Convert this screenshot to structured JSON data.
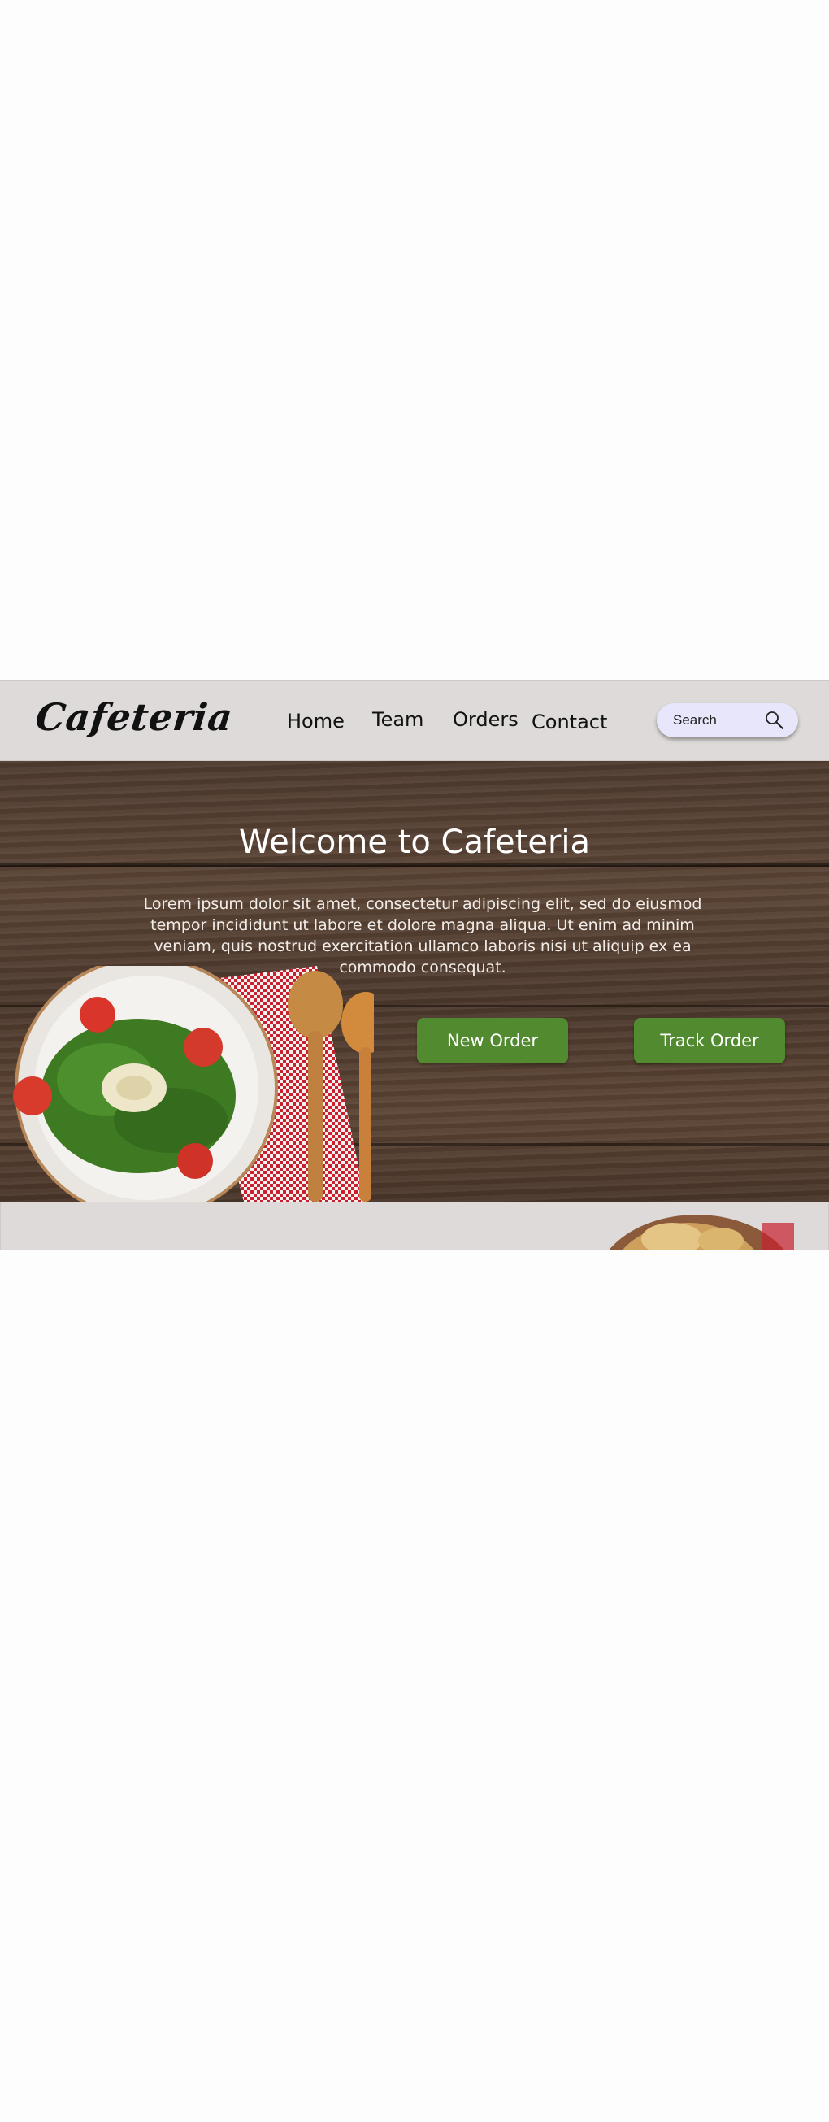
{
  "header": {
    "logo": "Cafeteria",
    "nav": [
      {
        "label": "Home"
      },
      {
        "label": "Team"
      },
      {
        "label": "Orders"
      },
      {
        "label": "Contact"
      }
    ],
    "search": {
      "placeholder": "Search",
      "icon": "search-icon"
    }
  },
  "hero": {
    "title": "Welcome to Cafeteria",
    "text": "Lorem ipsum dolor sit amet, consectetur adipiscing elit, sed do eiusmod tempor incididunt ut labore et dolore magna aliqua. Ut enim ad minim veniam, quis nostrud exercitation ullamco laboris nisi ut aliquip ex ea commodo consequat.",
    "buttons": {
      "new_order": "New Order",
      "track_order": "Track Order"
    },
    "background": "wooden-table-with-salad-image"
  },
  "colors": {
    "header_bg": "#dedada",
    "button_green": "#518a2f",
    "search_bg": "#e8e6fb",
    "page_bg": "#fdfdfd"
  }
}
